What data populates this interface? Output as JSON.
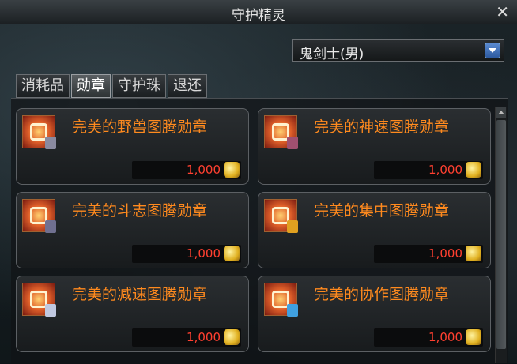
{
  "window": {
    "title": "守护精灵",
    "close_icon": "close-icon"
  },
  "class_select": {
    "value": "鬼剑士(男)"
  },
  "tabs": [
    {
      "label": "消耗品",
      "active": false
    },
    {
      "label": "勋章",
      "active": true
    },
    {
      "label": "守护珠",
      "active": false
    },
    {
      "label": "退还",
      "active": false
    }
  ],
  "items": [
    {
      "name": "完美的野兽图腾勋章",
      "price": "1,000",
      "badge_color": "#8a8aa0"
    },
    {
      "name": "完美的神速图腾勋章",
      "price": "1,000",
      "badge_color": "#a05070"
    },
    {
      "name": "完美的斗志图腾勋章",
      "price": "1,000",
      "badge_color": "#707090"
    },
    {
      "name": "完美的集中图腾勋章",
      "price": "1,000",
      "badge_color": "#e0a020"
    },
    {
      "name": "完美的减速图腾勋章",
      "price": "1,000",
      "badge_color": "#c0c8e0"
    },
    {
      "name": "完美的协作图腾勋章",
      "price": "1,000",
      "badge_color": "#40a0e0"
    }
  ]
}
